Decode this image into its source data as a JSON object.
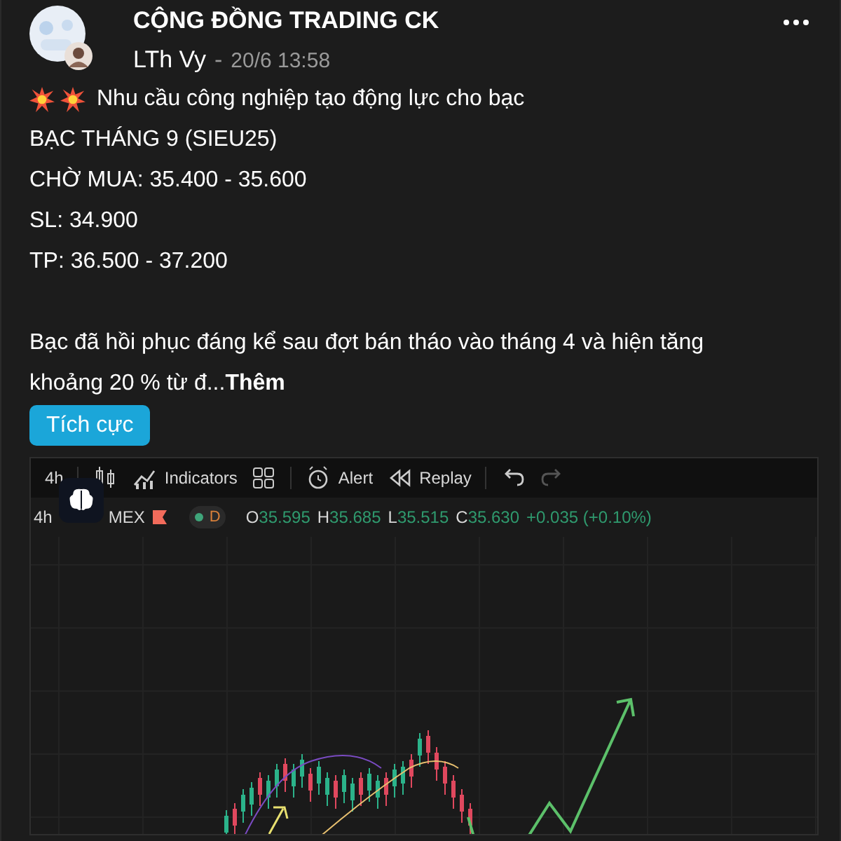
{
  "group": {
    "name": "CỘNG ĐỒNG TRADING CK"
  },
  "post": {
    "author": "LTh Vy",
    "separator": "-",
    "time": "20/6 13:58",
    "lines": [
      {
        "kind": "headline",
        "text": "Nhu cầu công nghiệp tạo động lực cho bạc"
      },
      {
        "kind": "plain",
        "text": "BẠC THÁNG 9 (SIEU25)"
      },
      {
        "kind": "plain",
        "text": "CHỜ MUA: 35.400 - 35.600"
      },
      {
        "kind": "plain",
        "text": "SL: 34.900"
      },
      {
        "kind": "plain",
        "text": "TP: 36.500 - 37.200"
      }
    ],
    "body": "Bạc đã hồi phục đáng kể sau đợt bán tháo vào tháng 4 và hiện tăng khoảng 20 % từ đ...",
    "more": "Thêm",
    "tag": "Tích cực"
  },
  "chart_screenshot": {
    "toolbar": [
      {
        "kind": "text",
        "label": "4h"
      },
      {
        "kind": "candles"
      },
      {
        "kind": "indicators",
        "label": "Indicators"
      },
      {
        "kind": "layouts"
      },
      {
        "kind": "alert",
        "label": "Alert"
      },
      {
        "kind": "replay",
        "label": "Replay"
      },
      {
        "kind": "undo"
      },
      {
        "kind": "redo"
      }
    ],
    "legend": {
      "interval": "4h",
      "symbol": "MEX",
      "badge": "D",
      "values": [
        {
          "key": "O",
          "value": "35.595"
        },
        {
          "key": "H",
          "value": "35.685"
        },
        {
          "key": "L",
          "value": "35.515"
        },
        {
          "key": "C",
          "value": "35.630"
        }
      ],
      "change": "+0.035 (+0.10%)"
    }
  }
}
